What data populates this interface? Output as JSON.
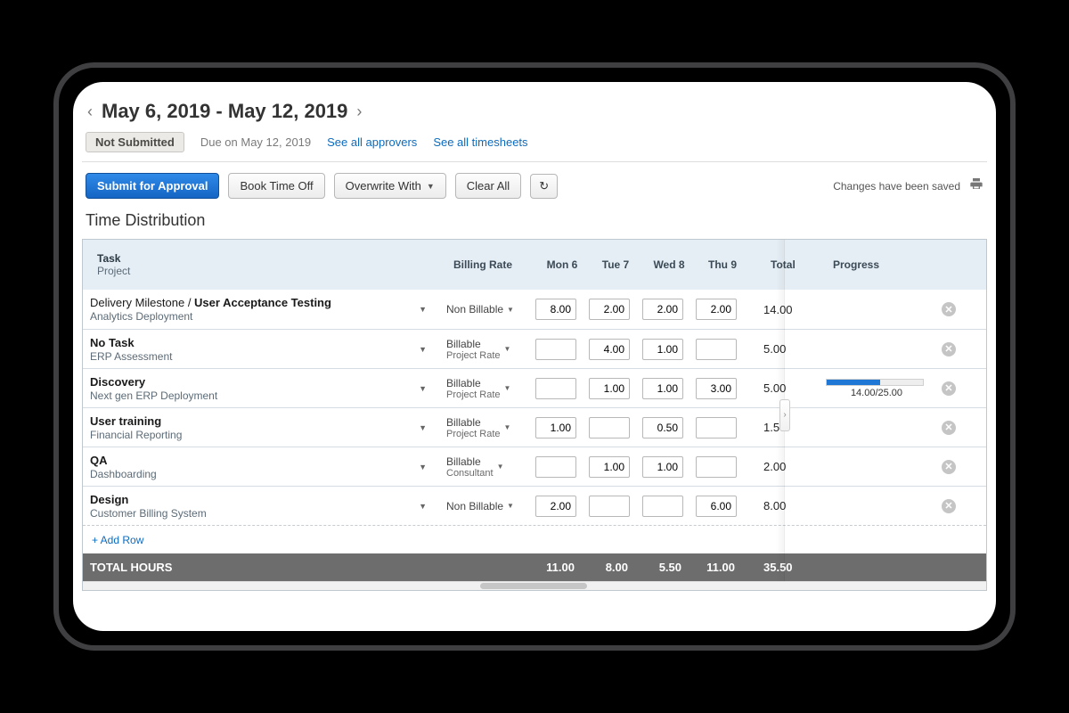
{
  "header": {
    "date_range": "May 6, 2019 - May 12, 2019",
    "status": "Not Submitted",
    "due": "Due on May 12, 2019",
    "see_approvers": "See all approvers",
    "see_timesheets": "See all timesheets"
  },
  "actions": {
    "submit": "Submit for Approval",
    "book_off": "Book Time Off",
    "overwrite": "Overwrite With",
    "clear_all": "Clear All",
    "saved_msg": "Changes have been saved"
  },
  "section_title": "Time Distribution",
  "columns": {
    "task": "Task",
    "project": "Project",
    "billing_rate": "Billing Rate",
    "days": [
      "Mon 6",
      "Tue 7",
      "Wed 8",
      "Thu 9"
    ],
    "total": "Total",
    "progress": "Progress"
  },
  "rows": [
    {
      "task_prefix": "Delivery Milestone / ",
      "task": "User Acceptance Testing",
      "project": "Analytics Deployment",
      "rate_line1": "Non Billable",
      "rate_line2": "",
      "hours": [
        "8.00",
        "2.00",
        "2.00",
        "2.00"
      ],
      "total": "14.00",
      "progress": null
    },
    {
      "task_prefix": "",
      "task": "No Task",
      "project": "ERP Assessment",
      "rate_line1": "Billable",
      "rate_line2": "Project Rate",
      "hours": [
        "",
        "4.00",
        "1.00",
        ""
      ],
      "total": "5.00",
      "progress": null
    },
    {
      "task_prefix": "",
      "task": "Discovery",
      "project": "Next gen ERP Deployment",
      "rate_line1": "Billable",
      "rate_line2": "Project Rate",
      "hours": [
        "",
        "1.00",
        "1.00",
        "3.00"
      ],
      "total": "5.00",
      "progress": {
        "value": 14.0,
        "max": 25.0,
        "label": "14.00/25.00"
      }
    },
    {
      "task_prefix": "",
      "task": "User training",
      "project": "Financial Reporting",
      "rate_line1": "Billable",
      "rate_line2": "Project Rate",
      "hours": [
        "1.00",
        "",
        "0.50",
        ""
      ],
      "total": "1.50",
      "progress": null
    },
    {
      "task_prefix": "",
      "task": "QA",
      "project": "Dashboarding",
      "rate_line1": "Billable",
      "rate_line2": "Consultant",
      "hours": [
        "",
        "1.00",
        "1.00",
        ""
      ],
      "total": "2.00",
      "progress": null
    },
    {
      "task_prefix": "",
      "task": "Design",
      "project": "Customer Billing System",
      "rate_line1": "Non Billable",
      "rate_line2": "",
      "hours": [
        "2.00",
        "",
        "",
        "6.00"
      ],
      "total": "8.00",
      "progress": null
    }
  ],
  "add_row": "+ Add Row",
  "totals": {
    "label": "TOTAL HOURS",
    "hours": [
      "11.00",
      "8.00",
      "5.50",
      "11.00"
    ],
    "grand": "35.50"
  }
}
